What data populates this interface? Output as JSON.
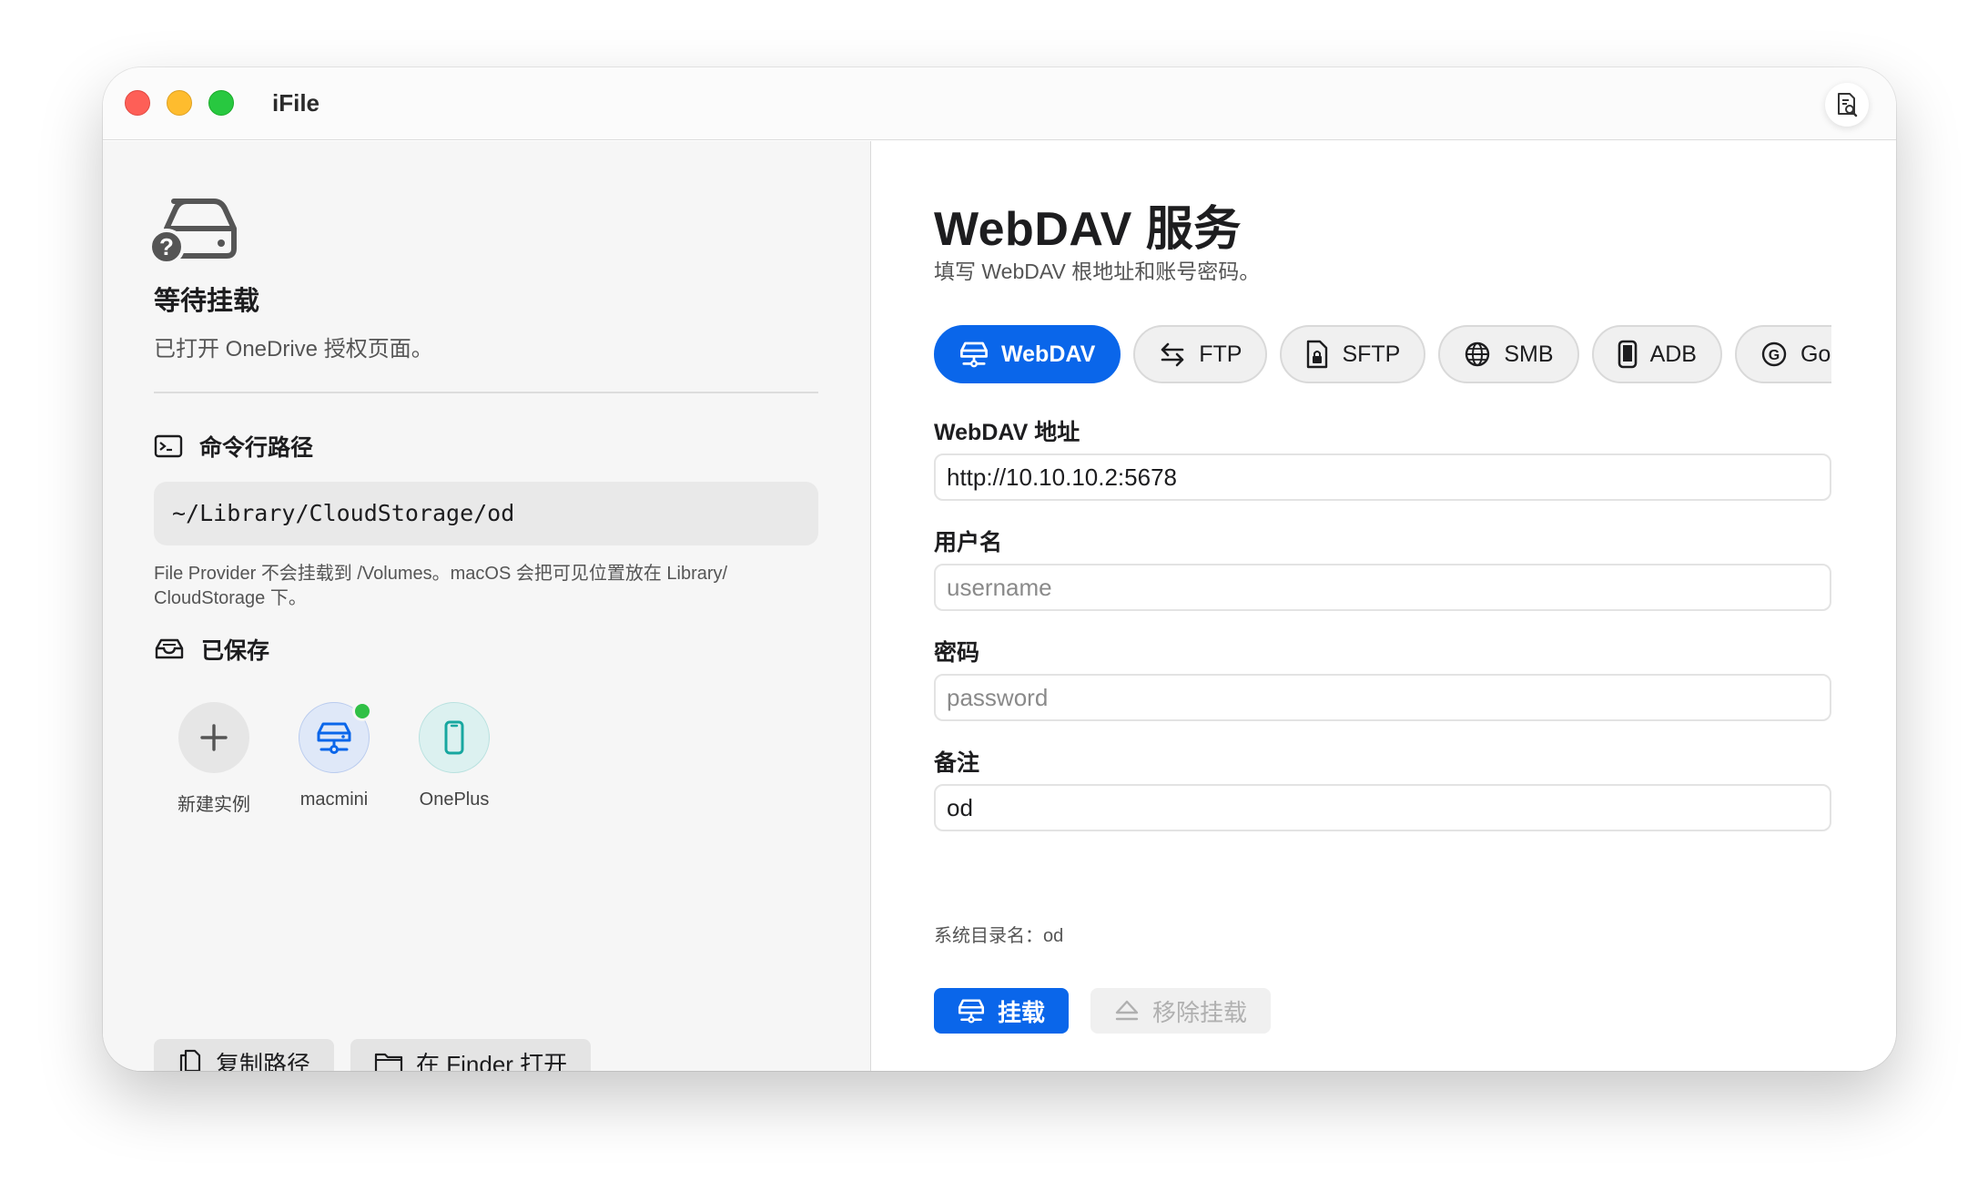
{
  "window": {
    "title": "iFile"
  },
  "sidebar": {
    "status": {
      "title": "等待挂载",
      "subtitle": "已打开 OneDrive 授权页面。"
    },
    "cli_path": {
      "heading": "命令行路径",
      "value": "~/Library/CloudStorage/od",
      "note": "File Provider 不会挂载到 /Volumes。macOS 会把可见位置放在 Library/ CloudStorage 下。"
    },
    "saved": {
      "heading": "已保存",
      "items": [
        {
          "label": "新建实例",
          "icon": "plus-icon"
        },
        {
          "label": "macmini",
          "icon": "server-icon",
          "online": true
        },
        {
          "label": "OnePlus",
          "icon": "phone-icon"
        }
      ]
    },
    "buttons": {
      "copy_path": "复制路径",
      "open_finder": "在 Finder 打开"
    }
  },
  "main": {
    "title": "WebDAV 服务",
    "subtitle": "填写 WebDAV 根地址和账号密码。",
    "protocols": [
      {
        "label": "WebDAV",
        "icon": "server-icon",
        "active": true
      },
      {
        "label": "FTP",
        "icon": "arrows-icon"
      },
      {
        "label": "SFTP",
        "icon": "lock-doc-icon"
      },
      {
        "label": "SMB",
        "icon": "globe-icon"
      },
      {
        "label": "ADB",
        "icon": "phone-icon"
      },
      {
        "label": "Goo",
        "icon": "google-icon"
      }
    ],
    "fields": {
      "address": {
        "label": "WebDAV 地址",
        "value": "http://10.10.10.2:5678"
      },
      "username": {
        "label": "用户名",
        "placeholder": "username"
      },
      "password": {
        "label": "密码",
        "placeholder": "password"
      },
      "note": {
        "label": "备注",
        "value": "od"
      }
    },
    "system_dir": "系统目录名：od",
    "actions": {
      "mount": "挂载",
      "unmount": "移除挂载"
    }
  },
  "colors": {
    "accent": "#0a66ea",
    "online": "#30c046"
  }
}
